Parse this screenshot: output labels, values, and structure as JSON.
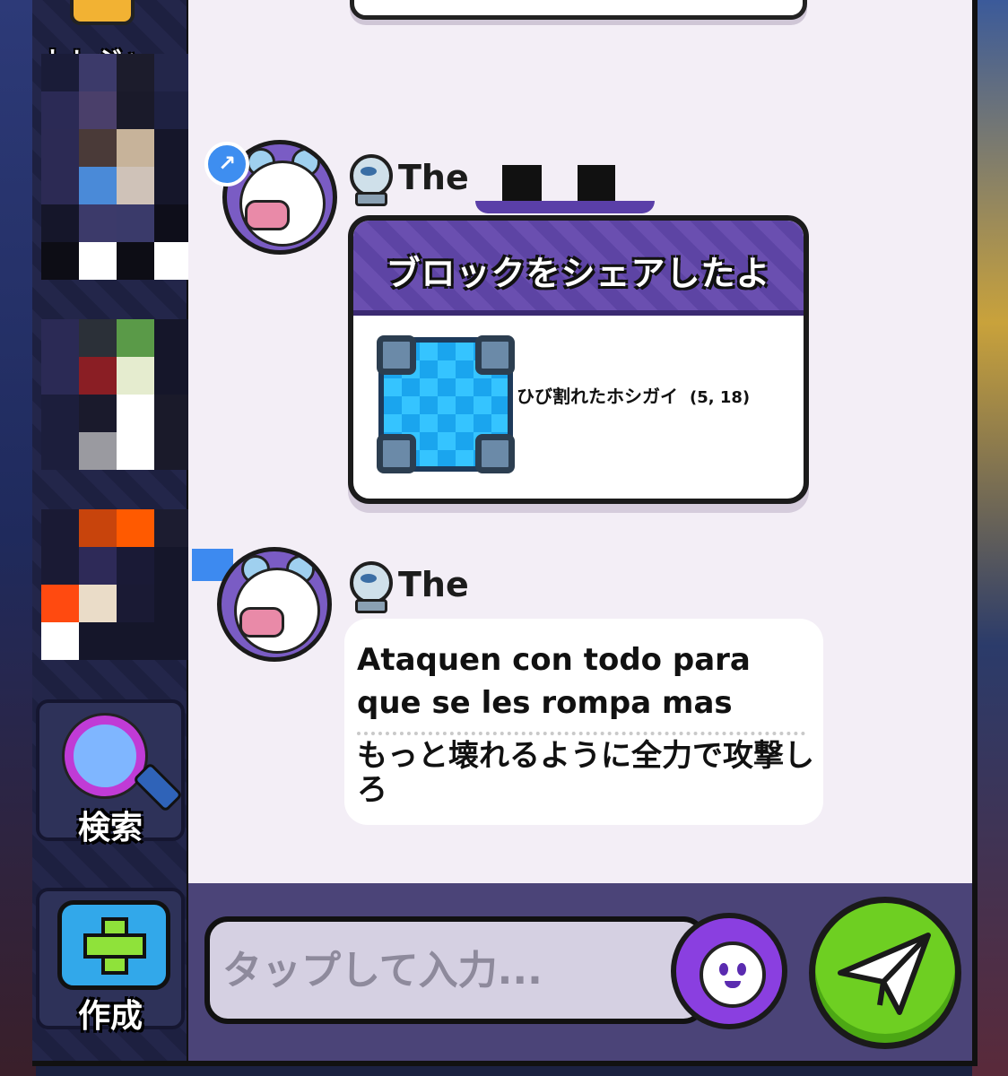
{
  "sidebar": {
    "treasure_label": "トレジャー",
    "search_label": "検索",
    "create_label": "作成"
  },
  "messages": [
    {
      "username": "Then",
      "type": "block_share",
      "share_title": "ブロックをシェアしたよ",
      "block_name": "ひび割れたホシガイ",
      "block_coords": "(5, 18)"
    },
    {
      "username": "Then",
      "type": "text",
      "original_text": "Ataquen con todo para que se les rompa mas",
      "translated_text": "もっと壊れるように全力で攻撃しろ"
    }
  ],
  "input": {
    "placeholder": "タップして入力..."
  },
  "colors": {
    "panel_background": "#f3eef6",
    "share_header": "#6a4fb0",
    "send_button": "#6ecf22",
    "emoji_button": "#8a3fe0",
    "input_bar": "#4b4478"
  }
}
